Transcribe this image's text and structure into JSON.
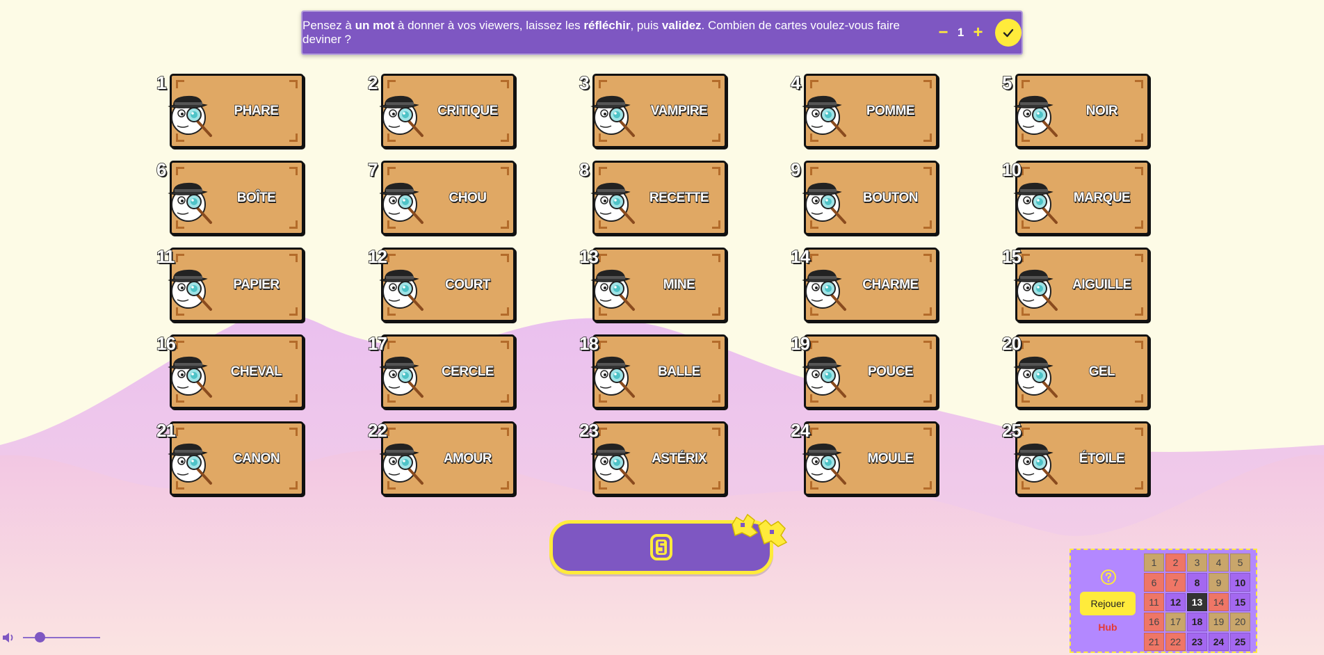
{
  "banner": {
    "part1": "Pensez à ",
    "b1": "un mot",
    "part2": " à donner à vos viewers, laissez les ",
    "b2": "réfléchir",
    "part3": ", puis ",
    "b3": "validez",
    "part4": ". Combien de cartes voulez-vous faire deviner ?",
    "minus": "−",
    "count": "1",
    "plus": "+"
  },
  "cards": [
    {
      "num": "1",
      "word": "PHARE"
    },
    {
      "num": "2",
      "word": "CRITIQUE"
    },
    {
      "num": "3",
      "word": "VAMPIRE"
    },
    {
      "num": "4",
      "word": "POMME"
    },
    {
      "num": "5",
      "word": "NOIR"
    },
    {
      "num": "6",
      "word": "BOÎTE"
    },
    {
      "num": "7",
      "word": "CHOU"
    },
    {
      "num": "8",
      "word": "RECETTE"
    },
    {
      "num": "9",
      "word": "BOUTON"
    },
    {
      "num": "10",
      "word": "MARQUE"
    },
    {
      "num": "11",
      "word": "PAPIER"
    },
    {
      "num": "12",
      "word": "COURT"
    },
    {
      "num": "13",
      "word": "MINE"
    },
    {
      "num": "14",
      "word": "CHARME"
    },
    {
      "num": "15",
      "word": "AIGUILLE"
    },
    {
      "num": "16",
      "word": "CHEVAL"
    },
    {
      "num": "17",
      "word": "CERCLE"
    },
    {
      "num": "18",
      "word": "BALLE"
    },
    {
      "num": "19",
      "word": "POUCE"
    },
    {
      "num": "20",
      "word": "GEL"
    },
    {
      "num": "21",
      "word": "CANON"
    },
    {
      "num": "22",
      "word": "AMOUR"
    },
    {
      "num": "23",
      "word": "ASTÉRIX"
    },
    {
      "num": "24",
      "word": "MOULE"
    },
    {
      "num": "25",
      "word": "ÉTOILE"
    }
  ],
  "panel": {
    "replay_label": "Rejouer",
    "hub_label": "Hub",
    "map": [
      {
        "n": "1",
        "team": "neutral"
      },
      {
        "n": "2",
        "team": "red"
      },
      {
        "n": "3",
        "team": "neutral"
      },
      {
        "n": "4",
        "team": "neutral"
      },
      {
        "n": "5",
        "team": "neutral"
      },
      {
        "n": "6",
        "team": "red"
      },
      {
        "n": "7",
        "team": "red"
      },
      {
        "n": "8",
        "team": "purple"
      },
      {
        "n": "9",
        "team": "neutral"
      },
      {
        "n": "10",
        "team": "purple"
      },
      {
        "n": "11",
        "team": "red"
      },
      {
        "n": "12",
        "team": "purple"
      },
      {
        "n": "13",
        "team": "black"
      },
      {
        "n": "14",
        "team": "red"
      },
      {
        "n": "15",
        "team": "purple"
      },
      {
        "n": "16",
        "team": "red"
      },
      {
        "n": "17",
        "team": "neutral"
      },
      {
        "n": "18",
        "team": "purple"
      },
      {
        "n": "19",
        "team": "neutral"
      },
      {
        "n": "20",
        "team": "neutral"
      },
      {
        "n": "21",
        "team": "red"
      },
      {
        "n": "22",
        "team": "red"
      },
      {
        "n": "23",
        "team": "purple"
      },
      {
        "n": "24",
        "team": "purple"
      },
      {
        "n": "25",
        "team": "purple"
      }
    ]
  },
  "volume": {
    "level": 0.22
  },
  "colors": {
    "accent": "#7e57c2",
    "yellow": "#ffeb3b",
    "card": "#e0a864",
    "background": "#fdfbe6",
    "hill": "#eac2ee"
  },
  "icons": {
    "confirm": "check-icon",
    "help": "question-circle-icon",
    "volume": "speaker-icon",
    "card_art": "detective-icon",
    "main_button": "coin-icon"
  }
}
